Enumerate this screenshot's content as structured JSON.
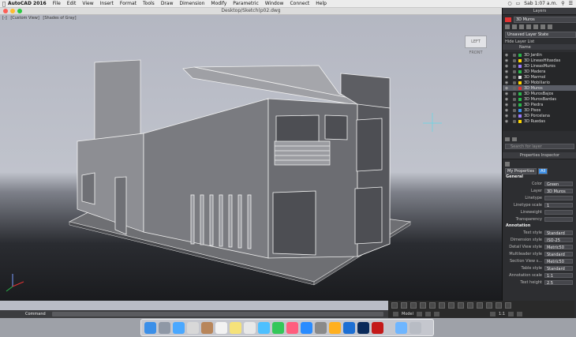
{
  "menubar": {
    "app": "AutoCAD 2016",
    "items": [
      "File",
      "Edit",
      "View",
      "Insert",
      "Format",
      "Tools",
      "Draw",
      "Dimension",
      "Modify",
      "Parametric",
      "Window",
      "Connect",
      "Help"
    ],
    "clock": "Sab 1:07 a.m."
  },
  "window": {
    "title": "Desktop/Sketch(p02.dwg"
  },
  "viewport": {
    "controls": [
      "[-]",
      "[Custom View]",
      "[Shades of Gray]"
    ],
    "viewcube": "LEFT  FRONT"
  },
  "layers_panel": {
    "title": "Layers",
    "current_layer": "3D Muros",
    "layer_state": "Unsaved Layer State",
    "hide_label": "Hide Layer List",
    "col_name": "Name",
    "layers": [
      {
        "name": "3D Jardin",
        "color": "#29b84b"
      },
      {
        "name": "3D LineasHitasdas",
        "color": "#ffd700"
      },
      {
        "name": "3D LineasMuros",
        "color": "#9a7bff"
      },
      {
        "name": "3D Madera",
        "color": "#29b84b"
      },
      {
        "name": "3D Marmol",
        "color": "#e0e0e0"
      },
      {
        "name": "3D Mobiliario",
        "color": "#ffd700"
      },
      {
        "name": "3D Muros",
        "color": "#e03333",
        "selected": true
      },
      {
        "name": "3D MurosBajos",
        "color": "#29b84b"
      },
      {
        "name": "3D MurosBardas",
        "color": "#29b84b"
      },
      {
        "name": "3D Piedra",
        "color": "#29b84b"
      },
      {
        "name": "3D Pisos",
        "color": "#3b8fe8"
      },
      {
        "name": "3D Porcelana",
        "color": "#9a7bff"
      },
      {
        "name": "3D Ruedas",
        "color": "#ffd700"
      }
    ],
    "search_placeholder": "Search for layer"
  },
  "properties": {
    "title": "Properties Inspector",
    "tabs": [
      "My Properties",
      "All"
    ],
    "general": "General",
    "annotation": "Annotation",
    "general_props": [
      {
        "k": "Color",
        "v": "Green"
      },
      {
        "k": "Layer",
        "v": "3D Muros"
      },
      {
        "k": "Linetype",
        "v": ""
      },
      {
        "k": "Linetype scale",
        "v": "1"
      },
      {
        "k": "Lineweight",
        "v": ""
      },
      {
        "k": "Transparency",
        "v": ""
      }
    ],
    "annotation_props": [
      {
        "k": "Text style",
        "v": "Standard"
      },
      {
        "k": "Dimension style",
        "v": "ISO-25"
      },
      {
        "k": "Detail View style",
        "v": "Metric50"
      },
      {
        "k": "Multileader style",
        "v": "Standard"
      },
      {
        "k": "Section View s...",
        "v": "Metric50"
      },
      {
        "k": "Table style",
        "v": "Standard"
      },
      {
        "k": "Annotation scale",
        "v": "1:1"
      },
      {
        "k": "Text height",
        "v": "2.5"
      }
    ]
  },
  "command": {
    "label": "Command"
  },
  "status": {
    "model": "Model",
    "scale": "1:1"
  },
  "colors": {
    "accent": "#3b8fe8",
    "panel": "#2d2e31"
  }
}
